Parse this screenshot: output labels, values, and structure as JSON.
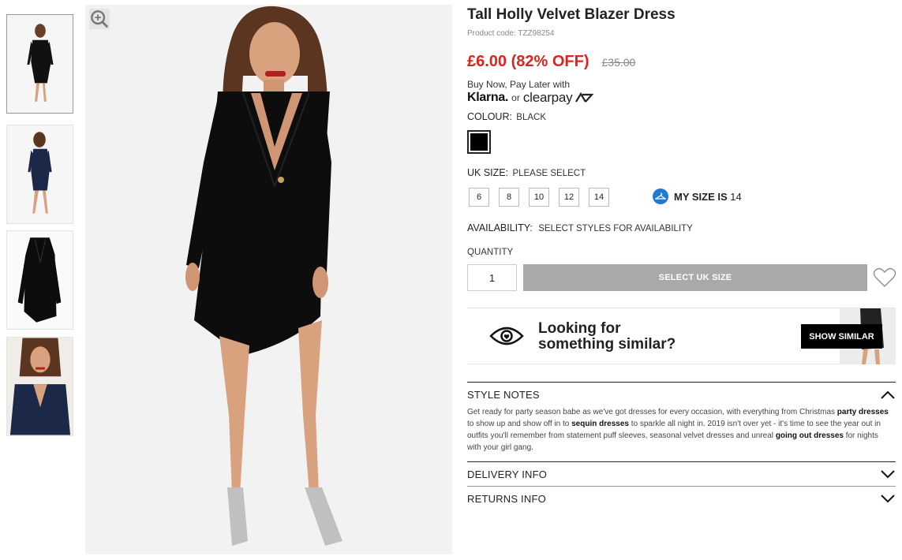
{
  "product": {
    "title": "Tall Holly Velvet Blazer Dress",
    "code_label": "Product code: TZZ98254",
    "price": "£6.00 (82% OFF)",
    "rrp": "£35.00"
  },
  "payment": {
    "bnpl_text": "Buy Now, Pay Later with",
    "klarna": "Klarna.",
    "or": "or",
    "clearpay": "clearpay"
  },
  "colour": {
    "label": "COLOUR:",
    "value": "BLACK",
    "swatch_color": "#000000"
  },
  "size": {
    "label": "UK SIZE:",
    "value": "PLEASE SELECT",
    "options": [
      "6",
      "8",
      "10",
      "12",
      "14"
    ],
    "my_size_label": "MY SIZE IS",
    "my_size_value": "14"
  },
  "availability": {
    "label": "AVAILABILITY:",
    "value": "SELECT STYLES FOR AVAILABILITY"
  },
  "quantity": {
    "label": "QUANTITY",
    "value": "1"
  },
  "add_button": "SELECT UK SIZE",
  "similar": {
    "line1": "Looking for",
    "line2": "something similar?",
    "button": "SHOW SIMILAR"
  },
  "style_notes": {
    "title": "STYLE NOTES",
    "t1": "Get ready for party season babe as we've got dresses for every occasion, with everything from Christmas ",
    "l1": "party dresses",
    "t2": " to show up and show off in to ",
    "l2": "sequin dresses",
    "t3": " to sparkle all night in. 2019 isn't over yet - it's time to see the year out in outfits you'll remember from statement puff sleeves, seasonal velvet dresses and unreal ",
    "l3": "going out dresses",
    "t4": " for nights with your girl gang."
  },
  "delivery": {
    "title": "DELIVERY INFO"
  },
  "returns": {
    "title": "RETURNS INFO"
  },
  "colors": {
    "price_red": "#e0211d",
    "button_grey": "#a9a9a9",
    "accent_blue": "#1e7ad6"
  }
}
